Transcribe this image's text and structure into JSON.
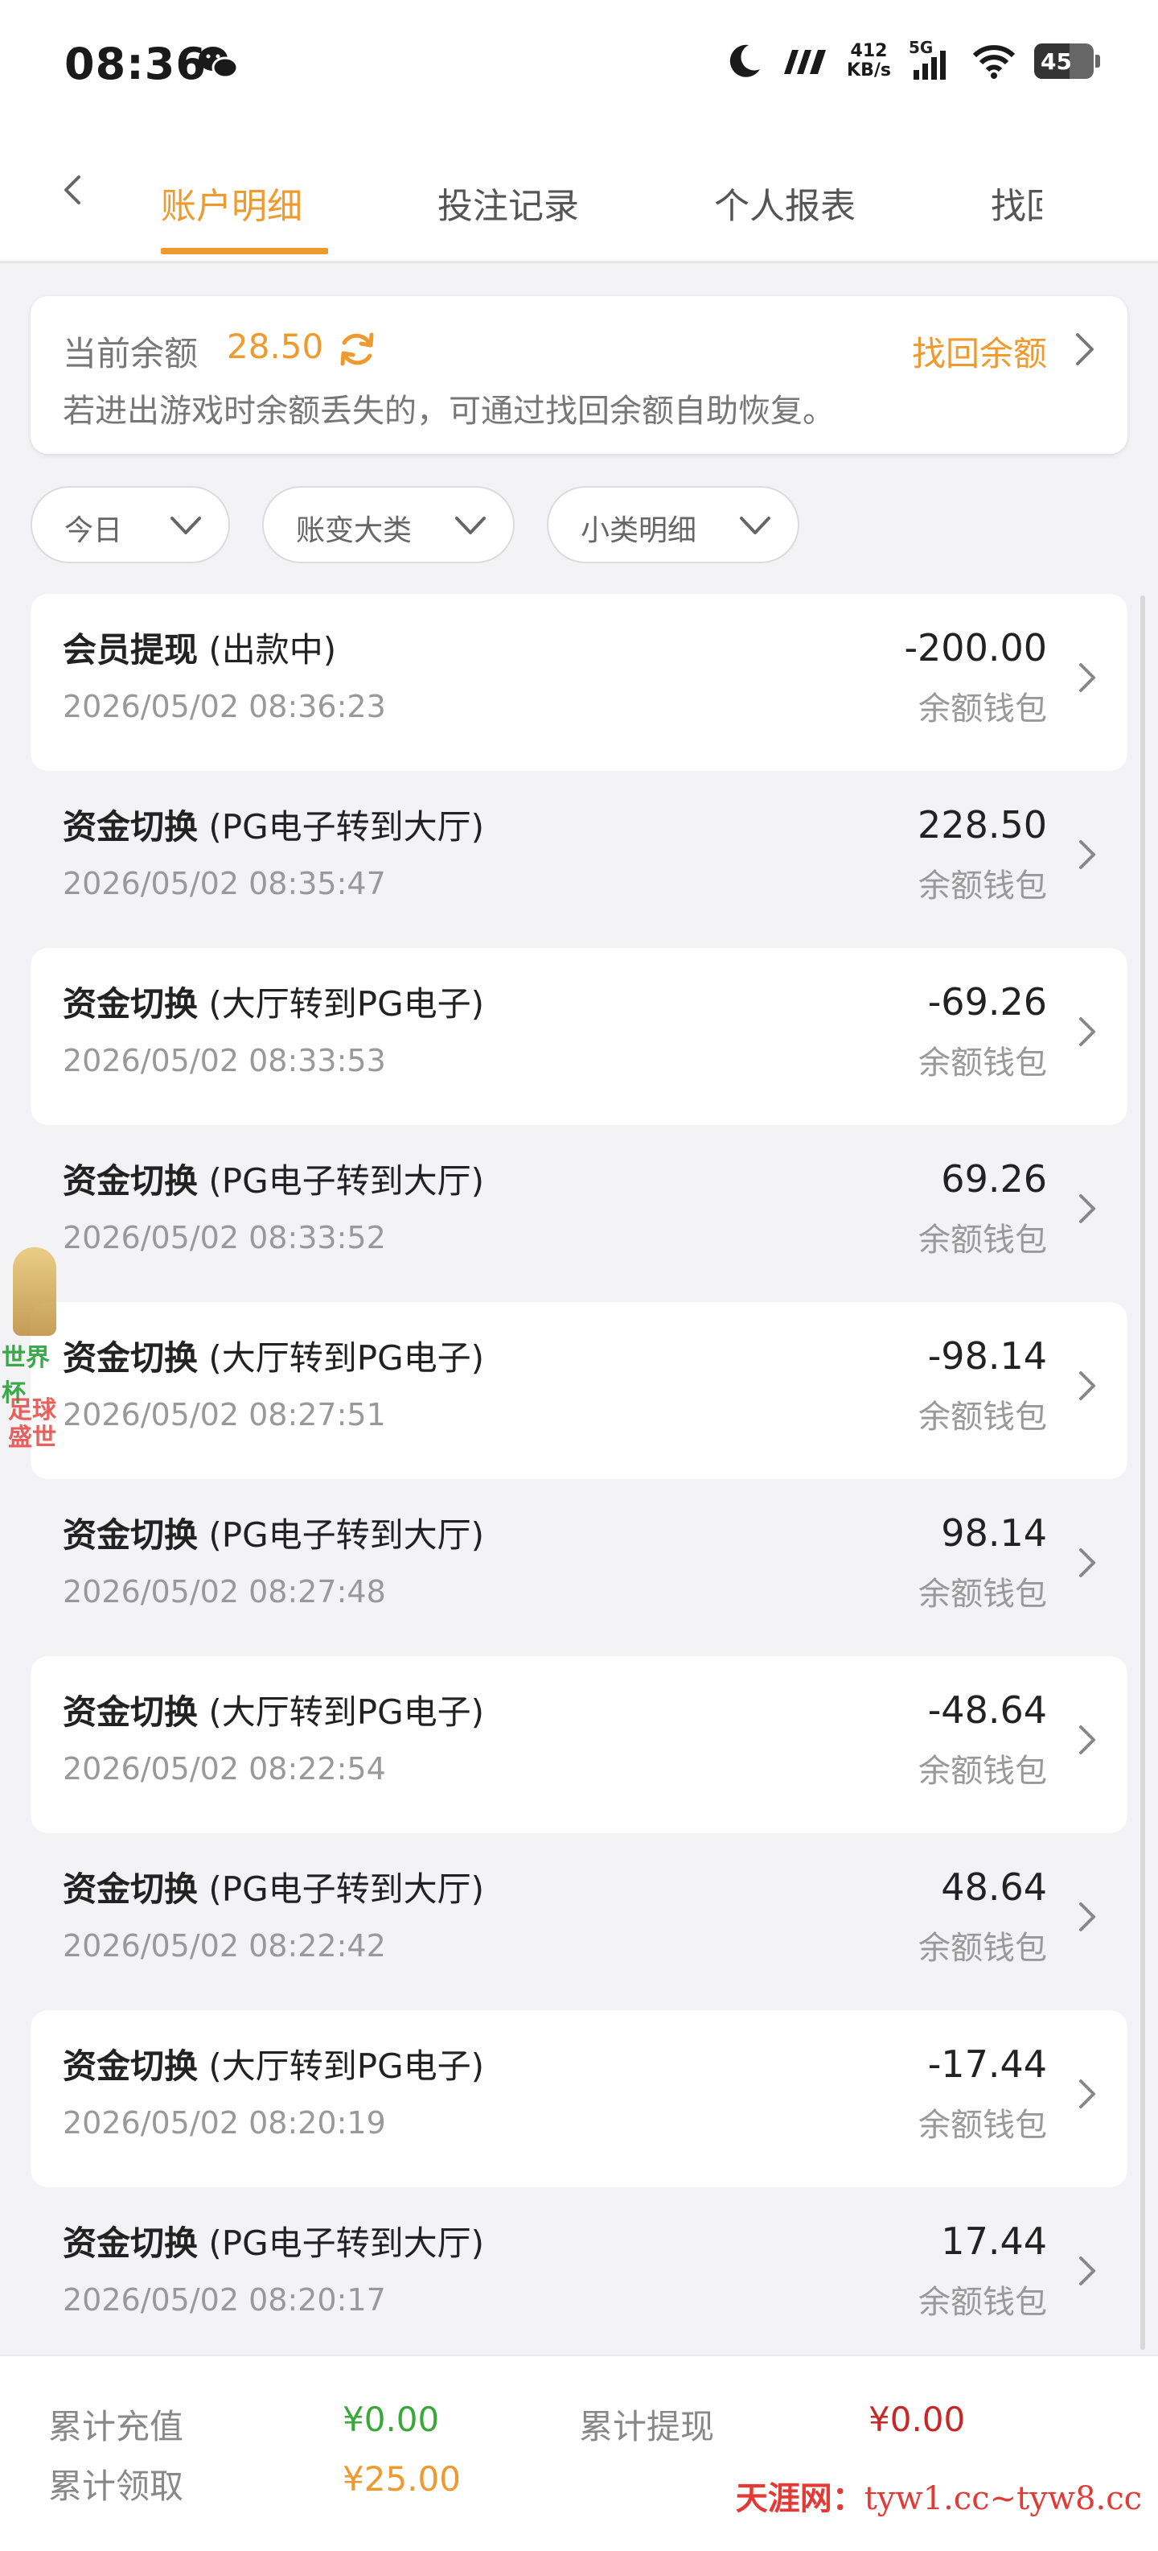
{
  "status_bar": {
    "time": "08:36",
    "net_speed_value": "412",
    "net_speed_unit": "KB/s",
    "network": "5G",
    "battery": "45",
    "icons": [
      "wechat-icon",
      "moon-icon",
      "signal-icon",
      "wifi-icon",
      "battery-icon"
    ]
  },
  "tabs": [
    {
      "label": "账户明细",
      "active": true
    },
    {
      "label": "投注记录",
      "active": false
    },
    {
      "label": "个人报表",
      "active": false
    },
    {
      "label": "找回",
      "active": false
    }
  ],
  "balance": {
    "label": "当前余额",
    "value": "28.50",
    "recover_label": "找回余额",
    "note": "若进出游戏时余额丢失的，可通过找回余额自助恢复。"
  },
  "filters": [
    {
      "label": "今日"
    },
    {
      "label": "账变大类"
    },
    {
      "label": "小类明细"
    }
  ],
  "transactions": [
    {
      "title": "会员提现",
      "detail": "(出款中)",
      "time": "2026/05/02 08:36:23",
      "amount": "-200.00",
      "wallet": "余额钱包"
    },
    {
      "title": "资金切换",
      "detail": "(PG电子转到大厅)",
      "time": "2026/05/02 08:35:47",
      "amount": "228.50",
      "wallet": "余额钱包"
    },
    {
      "title": "资金切换",
      "detail": "(大厅转到PG电子)",
      "time": "2026/05/02 08:33:53",
      "amount": "-69.26",
      "wallet": "余额钱包"
    },
    {
      "title": "资金切换",
      "detail": "(PG电子转到大厅)",
      "time": "2026/05/02 08:33:52",
      "amount": "69.26",
      "wallet": "余额钱包"
    },
    {
      "title": "资金切换",
      "detail": "(大厅转到PG电子)",
      "time": "2026/05/02 08:27:51",
      "amount": "-98.14",
      "wallet": "余额钱包"
    },
    {
      "title": "资金切换",
      "detail": "(PG电子转到大厅)",
      "time": "2026/05/02 08:27:48",
      "amount": "98.14",
      "wallet": "余额钱包"
    },
    {
      "title": "资金切换",
      "detail": "(大厅转到PG电子)",
      "time": "2026/05/02 08:22:54",
      "amount": "-48.64",
      "wallet": "余额钱包"
    },
    {
      "title": "资金切换",
      "detail": "(PG电子转到大厅)",
      "time": "2026/05/02 08:22:42",
      "amount": "48.64",
      "wallet": "余额钱包"
    },
    {
      "title": "资金切换",
      "detail": "(大厅转到PG电子)",
      "time": "2026/05/02 08:20:19",
      "amount": "-17.44",
      "wallet": "余额钱包"
    },
    {
      "title": "资金切换",
      "detail": "(PG电子转到大厅)",
      "time": "2026/05/02 08:20:17",
      "amount": "17.44",
      "wallet": "余额钱包"
    }
  ],
  "float_ad": {
    "line1": "世界杯",
    "line2": "足球",
    "line3": "盛世"
  },
  "footer": {
    "recharge_label": "累计充值",
    "recharge_value": "¥0.00",
    "withdraw_label": "累计提现",
    "withdraw_value": "¥0.00",
    "claim_label": "累计领取",
    "claim_value": "¥25.00",
    "colors": {
      "recharge": "#3aa838",
      "withdraw": "#c62828",
      "claim": "#ee9a2e"
    }
  },
  "watermark": {
    "site": "天涯网：",
    "url": "tyw1.cc~tyw8.cc"
  },
  "theme": {
    "accent": "#ee9a2e",
    "background": "#f3f3f5"
  }
}
